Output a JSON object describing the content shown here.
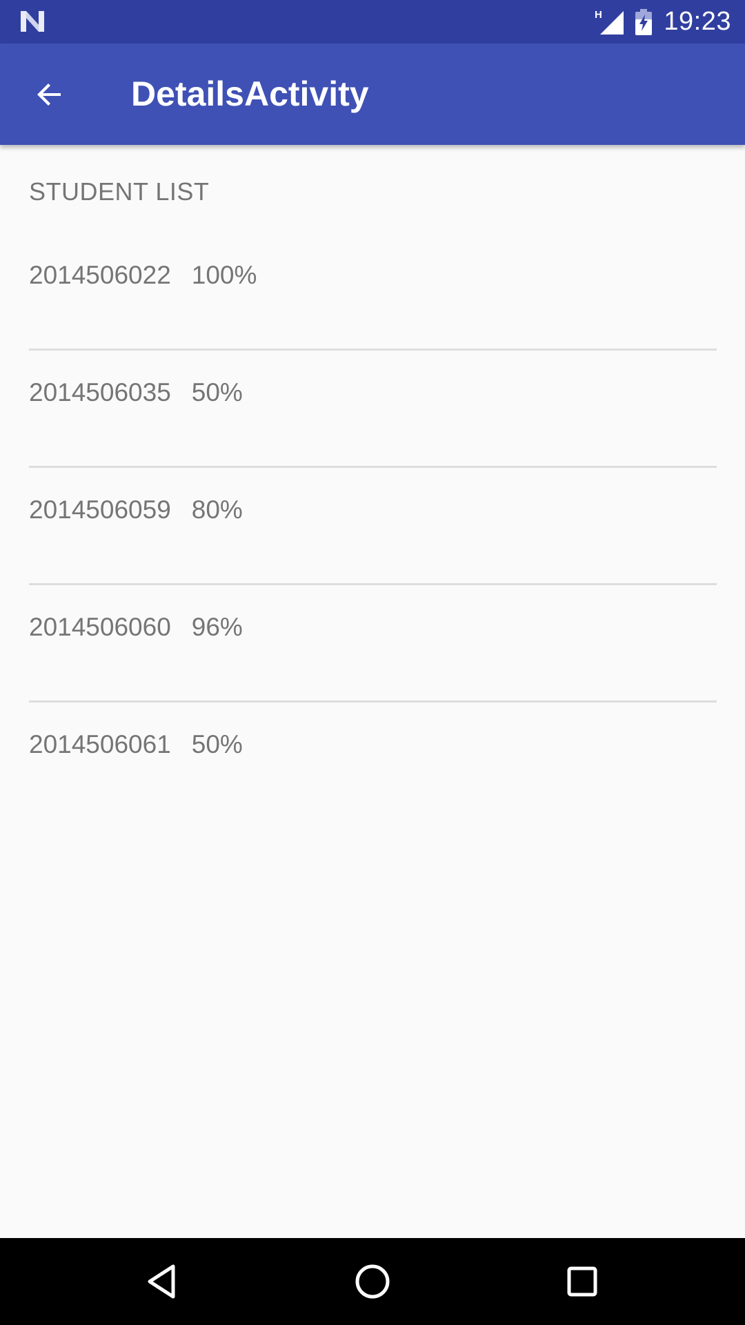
{
  "status_bar": {
    "time": "19:23",
    "network_label": "H",
    "left_icon": "n-logo-icon",
    "signal_icon": "cell-signal-icon",
    "battery_icon": "battery-charging-icon"
  },
  "app_bar": {
    "title": "DetailsActivity",
    "back_icon": "arrow-back-icon",
    "color": "#3f51b5",
    "status_color": "#303f9f"
  },
  "content": {
    "section_title": "STUDENT LIST",
    "students": [
      {
        "id": "2014506022",
        "percent": "100%"
      },
      {
        "id": "2014506035",
        "percent": "50%"
      },
      {
        "id": "2014506059",
        "percent": "80%"
      },
      {
        "id": "2014506060",
        "percent": "96%"
      },
      {
        "id": "2014506061",
        "percent": "50%"
      }
    ]
  },
  "nav_bar": {
    "back_icon": "triangle-back-icon",
    "home_icon": "circle-home-icon",
    "recents_icon": "square-recents-icon"
  }
}
